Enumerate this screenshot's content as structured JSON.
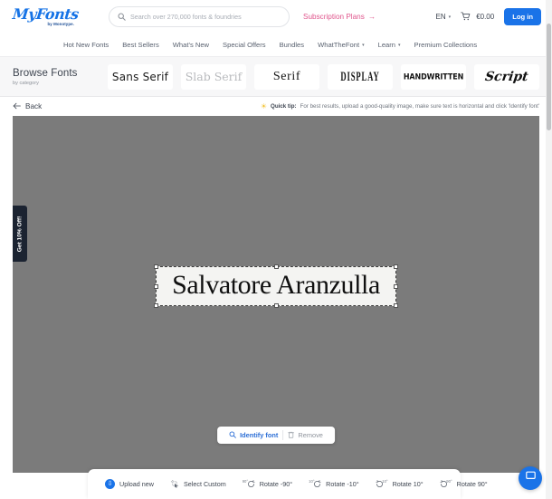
{
  "header": {
    "logo_main": "MyFonts",
    "logo_sub": "by Monotype.",
    "search_placeholder": "Search over 270,000 fonts & foundries",
    "search_value": "",
    "search_icon": "search-icon",
    "subscription_label": "Subscription Plans",
    "subscription_arrow": "→",
    "language": "EN",
    "language_caret": "▾",
    "cart_icon": "cart-icon",
    "cart_amount": "€0.00",
    "login_label": "Log in",
    "accent_blue": "#1a73e8",
    "accent_pink": "#e0558c"
  },
  "nav": {
    "items": [
      {
        "label": "Hot New Fonts",
        "caret": ""
      },
      {
        "label": "Best Sellers",
        "caret": ""
      },
      {
        "label": "What's New",
        "caret": ""
      },
      {
        "label": "Special Offers",
        "caret": ""
      },
      {
        "label": "Bundles",
        "caret": ""
      },
      {
        "label": "WhatTheFont",
        "caret": "▾"
      },
      {
        "label": "Learn",
        "caret": "▾"
      },
      {
        "label": "Premium Collections",
        "caret": ""
      }
    ]
  },
  "browse": {
    "title": "Browse Fonts",
    "subtitle": "by category",
    "categories": [
      {
        "label": "Sans Serif"
      },
      {
        "label": "Slab Serif"
      },
      {
        "label": "Serif"
      },
      {
        "label": "DISPLAY"
      },
      {
        "label": "HANDWRITTEN"
      },
      {
        "label": "Script"
      }
    ]
  },
  "tipbar": {
    "back_label": "Back",
    "back_icon": "arrow-left-icon",
    "bulb_icon": "lightbulb-icon",
    "tip_label": "Quick tip:",
    "tip_text": "For best results, upload a good-quality image, make sure text is horizontal and click 'Identify font'"
  },
  "canvas": {
    "background_color": "#7b7b7b",
    "uploaded_text": "Salvatore Aranzulla",
    "selection_box": "crop-selection"
  },
  "actions": {
    "identify_label": "Identify font",
    "identify_icon": "search-icon",
    "remove_label": "Remove",
    "remove_icon": "trash-icon"
  },
  "promo": {
    "label": "Get 10% Off!"
  },
  "toolbar": {
    "upload_label": "Upload new",
    "upload_icon": "upload-circle-icon",
    "select_custom_label": "Select Custom",
    "select_custom_icon": "crop-cursor-icon",
    "rotations": [
      {
        "label": "Rotate -90°",
        "deg": "90°",
        "dir": "ccw"
      },
      {
        "label": "Rotate -10°",
        "deg": "10°",
        "dir": "ccw"
      },
      {
        "label": "Rotate 10°",
        "deg": "10°",
        "dir": "cw"
      },
      {
        "label": "Rotate 90°",
        "deg": "90°",
        "dir": "cw"
      }
    ]
  },
  "chat": {
    "icon": "chat-bubble-icon"
  }
}
